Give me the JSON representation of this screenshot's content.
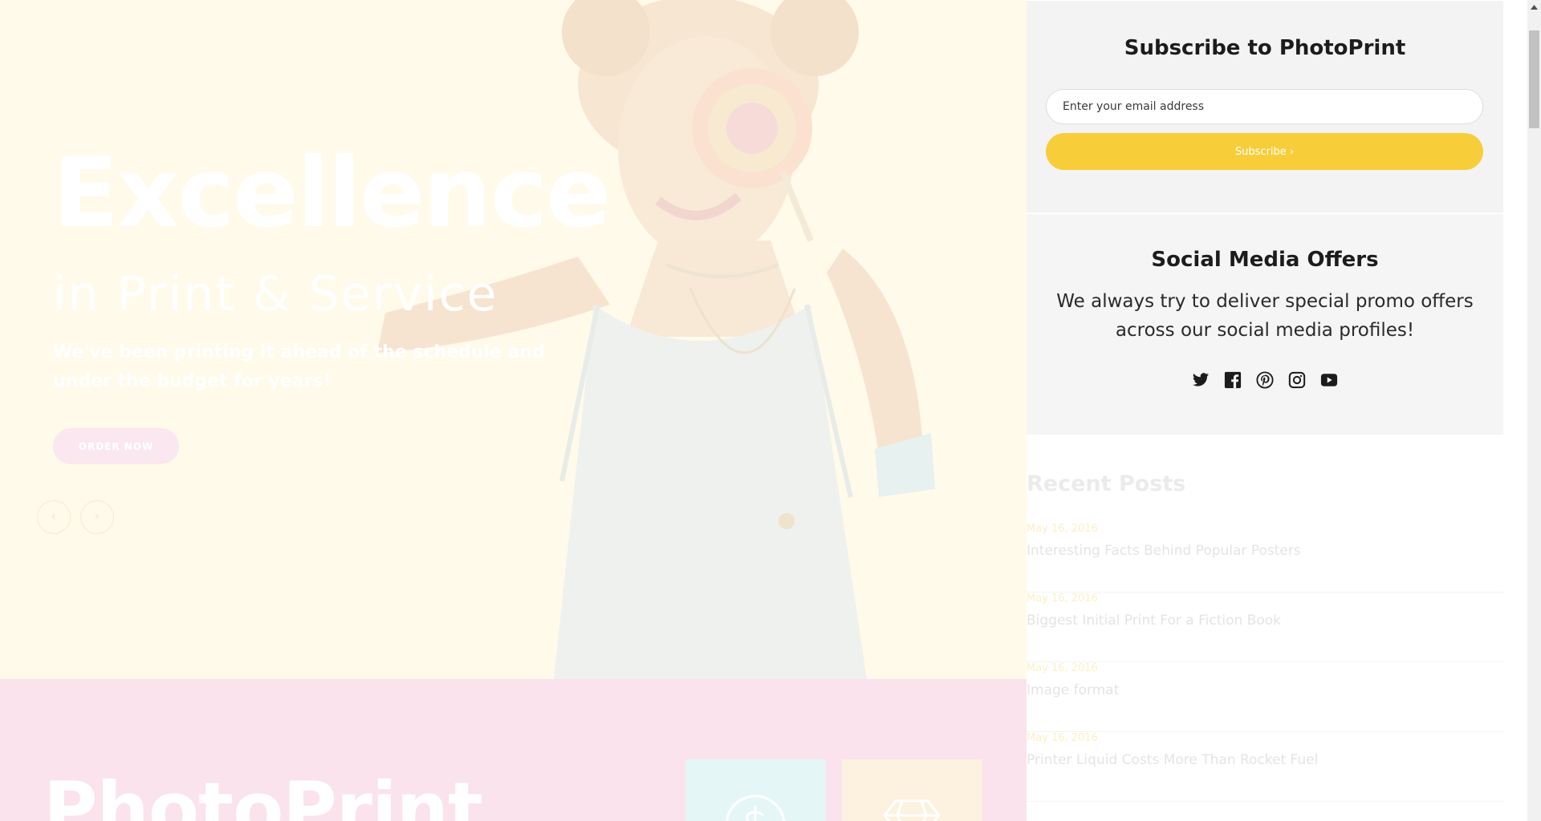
{
  "hero": {
    "title": "Excellence",
    "subtitle": "in Print & Service",
    "description": "We've been printing it ahead of the schedule and under the budget for years!",
    "cta_label": "ORDER NOW",
    "prev_arrow": "‹",
    "next_arrow": "›"
  },
  "brand_section": {
    "title": "PhotoPrint",
    "cards": [
      {
        "icon": "dollar-icon",
        "color": "#e5f6f6"
      },
      {
        "icon": "diamond-icon",
        "color": "#fdf1df"
      }
    ]
  },
  "subscribe": {
    "title": "Subscribe to PhotoPrint",
    "email_placeholder": "Enter your email address",
    "button_label": "Subscribe ›",
    "button_color": "#f7cd3a"
  },
  "social": {
    "title": "Social Media Offers",
    "text": "We always try to deliver special promo offers across our social media profiles!",
    "icons": [
      "twitter-icon",
      "facebook-icon",
      "pinterest-icon",
      "instagram-icon",
      "youtube-icon"
    ]
  },
  "recent_posts": {
    "title": "Recent Posts",
    "items": [
      {
        "date": "May 16, 2016",
        "title": "Interesting Facts Behind Popular Posters"
      },
      {
        "date": "May 16, 2016",
        "title": "Biggest Initial Print For a Fiction Book"
      },
      {
        "date": "May 16, 2016",
        "title": "Image format"
      },
      {
        "date": "May 16, 2016",
        "title": "Printer Liquid Costs More Than Rocket Fuel"
      }
    ]
  },
  "colors": {
    "hero_bg": "#fffaea",
    "brand_bg": "#fae3ec",
    "accent_yellow": "#f7cd3a",
    "cta_pink": "#fbe7ef"
  }
}
